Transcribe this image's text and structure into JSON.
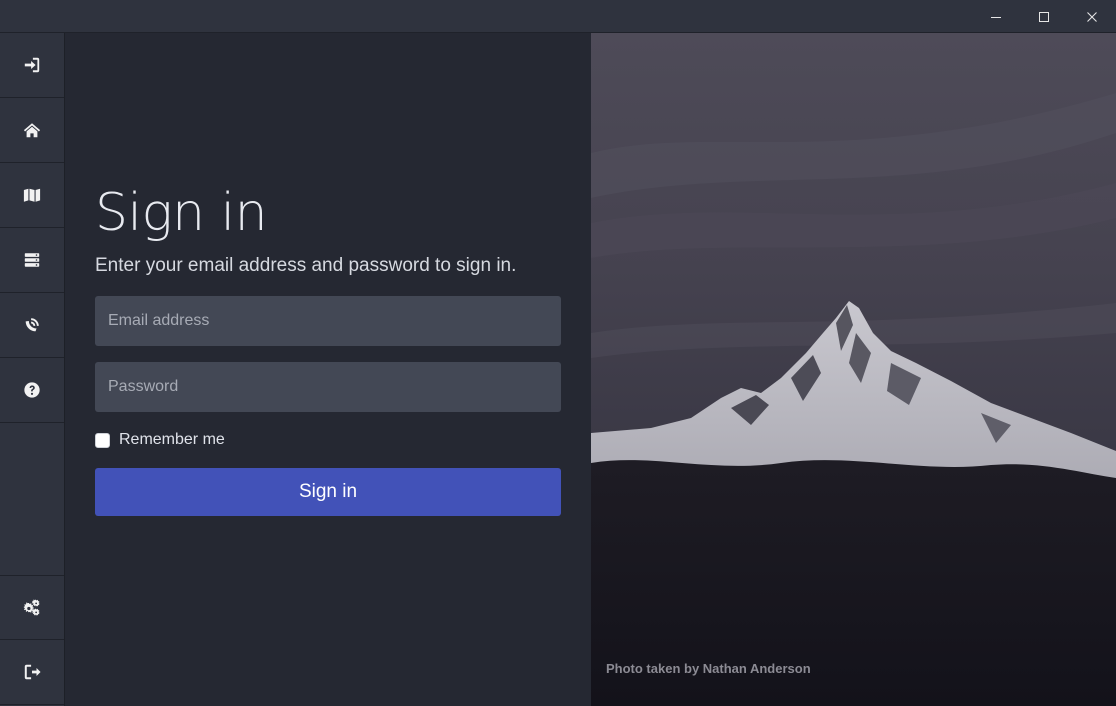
{
  "window": {
    "minimize_icon": "minimize-icon",
    "maximize_icon": "maximize-icon",
    "close_icon": "close-icon"
  },
  "sidebar": {
    "items": [
      {
        "icon": "sign-in-icon"
      },
      {
        "icon": "home-icon"
      },
      {
        "icon": "map-icon"
      },
      {
        "icon": "server-icon"
      },
      {
        "icon": "satellite-dish-icon"
      },
      {
        "icon": "help-icon"
      }
    ],
    "bottom_items": [
      {
        "icon": "settings-cogs-icon"
      },
      {
        "icon": "sign-out-icon"
      }
    ]
  },
  "signin": {
    "title": "Sign in",
    "subtitle": "Enter your email address and password to sign in.",
    "email_placeholder": "Email address",
    "email_value": "",
    "password_placeholder": "Password",
    "password_value": "",
    "remember_label": "Remember me",
    "remember_checked": false,
    "button_label": "Sign in"
  },
  "photo": {
    "credit": "Photo taken by Nathan Anderson"
  },
  "colors": {
    "accent": "#4252b8",
    "sidebar_bg": "#2f333e",
    "main_bg": "#252832",
    "field_bg": "#434855"
  }
}
